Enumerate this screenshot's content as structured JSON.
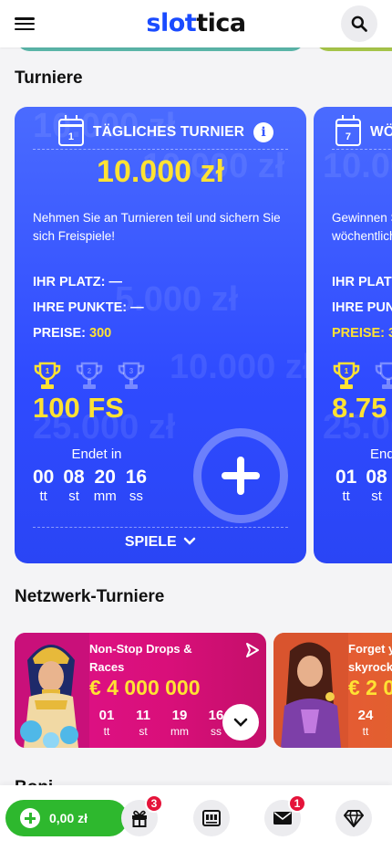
{
  "header": {
    "logo_part1": "slot",
    "logo_part2": "tica"
  },
  "sections": {
    "tournaments": "Turniere",
    "network": "Netzwerk-Turniere",
    "bonus_partial": "Boni"
  },
  "tournaments": [
    {
      "cal_day": "1",
      "title": "TÄGLICHES TURNIER",
      "prize": "10.000 zł",
      "description": "Nehmen Sie an Turnieren teil und sichern Sie sich Freispiele!",
      "place_label": "IHR PLATZ:",
      "place_value": "—",
      "points_label": "IHRE PUNKTE:",
      "points_value": "—",
      "prizes_label": "PREISE:",
      "prizes_value": "300",
      "top_prize": "100 FS",
      "ends_label": "Endet in",
      "timer": [
        {
          "n": "00",
          "l": "tt"
        },
        {
          "n": "08",
          "l": "st"
        },
        {
          "n": "20",
          "l": "mm"
        },
        {
          "n": "16",
          "l": "ss"
        }
      ],
      "games_label": "SPIELE"
    },
    {
      "cal_day": "7",
      "title": "WÖ",
      "prize": "",
      "description": "Gewinnen S wöchentlich",
      "place_label": "IHR PLAT",
      "points_label": "IHRE PUN",
      "prizes_label": "PREISE: 3",
      "top_prize": "8.75",
      "ends_label": "End",
      "timer": [
        {
          "n": "01",
          "l": "tt"
        },
        {
          "n": "08",
          "l": "st"
        }
      ]
    }
  ],
  "ghost_texts": [
    "10.000 zł",
    "5.000 zł",
    "10.000 zł",
    "25.000 zł"
  ],
  "network": [
    {
      "title": "Non-Stop Drops & Races",
      "amount": "€ 4 000 000",
      "timer": [
        {
          "n": "01",
          "l": "tt"
        },
        {
          "n": "11",
          "l": "st"
        },
        {
          "n": "19",
          "l": "mm"
        },
        {
          "n": "16",
          "l": "ss"
        }
      ]
    },
    {
      "title": "Forget y skyrock",
      "amount": "€ 2 0",
      "timer": [
        {
          "n": "24",
          "l": "tt"
        }
      ]
    }
  ],
  "bottom_nav": {
    "balance": "0,00 zł",
    "gift_badge": "3",
    "mail_badge": "1"
  },
  "colors": {
    "brand_blue": "#1a4bff",
    "card_blue": "#3556ff",
    "prize_yellow": "#ffe233",
    "balance_green": "#2eb82e",
    "badge_red": "#e5133a"
  }
}
